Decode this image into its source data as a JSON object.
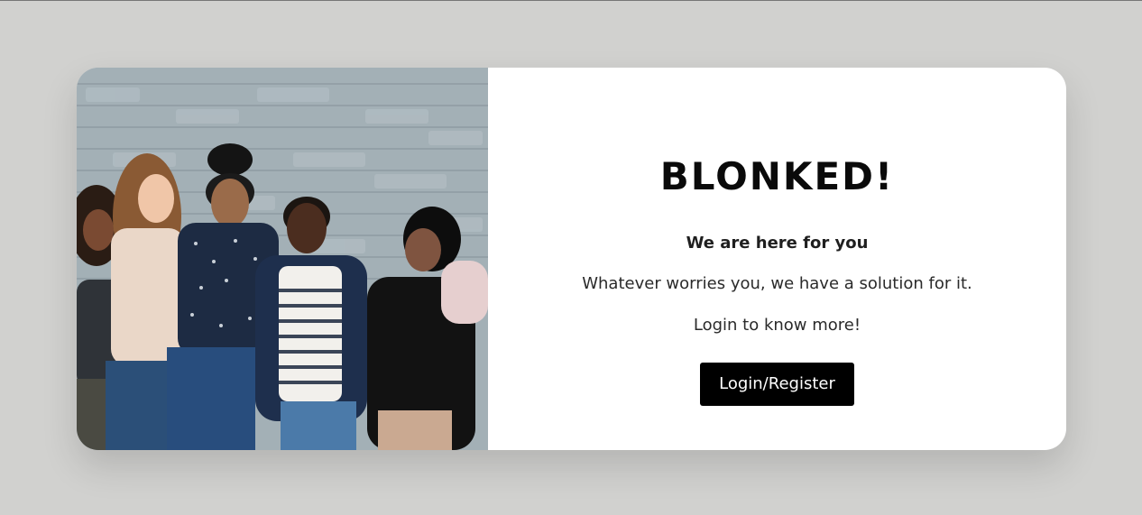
{
  "hero_image": {
    "description_icon": "group-photo-icon"
  },
  "content": {
    "title": "BLONKED!",
    "tagline": "We are here for you",
    "description": "Whatever worries you, we have a solution for it.",
    "cta_text": "Login to know more!",
    "login_button_label": "Login/Register"
  },
  "colors": {
    "page_background": "#d1d1cf",
    "card_background": "#ffffff",
    "button_background": "#000000",
    "button_text": "#ffffff",
    "title_text": "#0a0a0a"
  }
}
